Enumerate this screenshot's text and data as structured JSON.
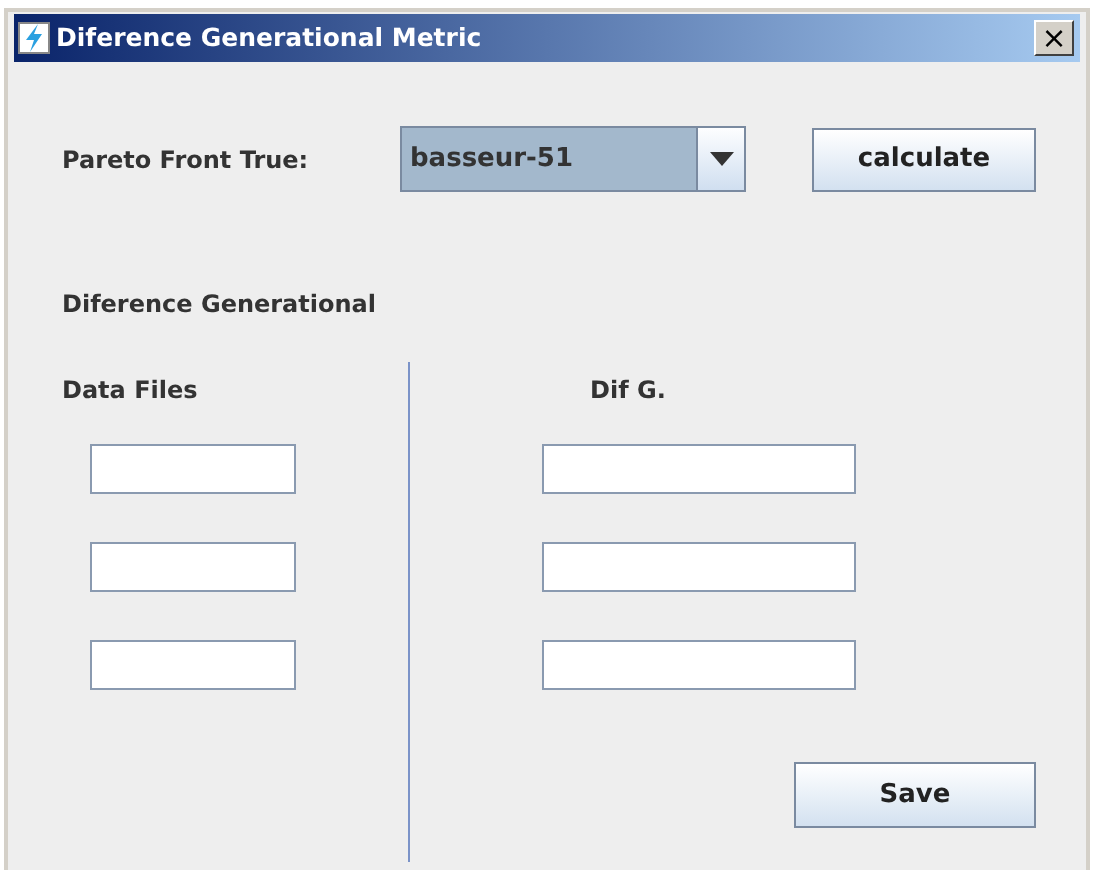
{
  "window": {
    "title": "Diference Generational Metric",
    "close_glyph": "×"
  },
  "pareto": {
    "label": "Pareto Front True:",
    "value": "basseur-51"
  },
  "calculate_button": "calculate",
  "section_title": "Diference Generational",
  "data_files": {
    "heading": "Data Files",
    "fields": [
      {
        "kind": "text"
      },
      {
        "kind": "text"
      },
      {
        "kind": "text"
      }
    ]
  },
  "dif_g": {
    "heading": "Dif G.",
    "fields": [
      {
        "kind": "text"
      },
      {
        "kind": "text"
      },
      {
        "kind": "text"
      }
    ]
  },
  "save_button": "Save"
}
